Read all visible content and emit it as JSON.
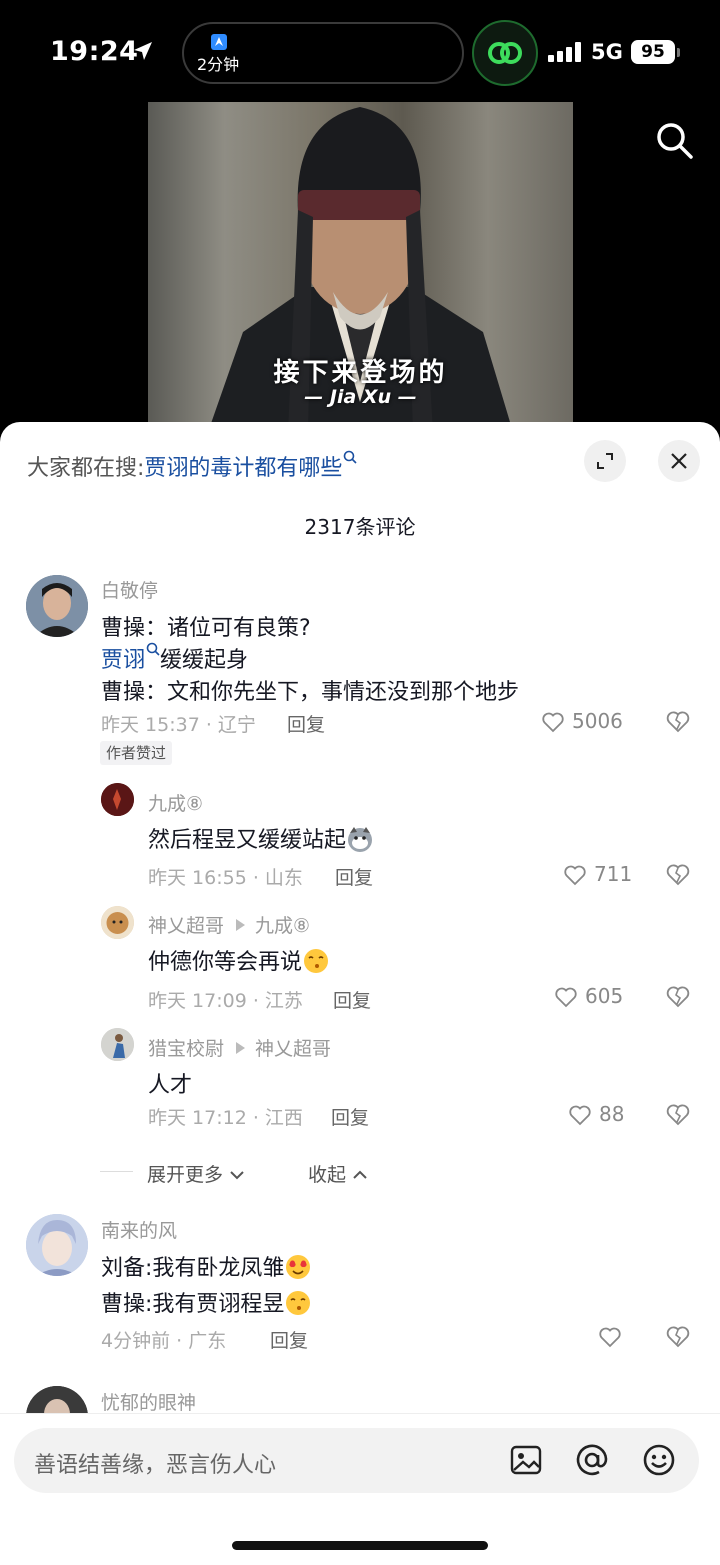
{
  "status_bar": {
    "time": "19:24",
    "island_text": "2分钟",
    "network": "5G",
    "battery": "95"
  },
  "video": {
    "subtitle_cn": "接下来登场的",
    "subtitle_en": "— Jia Xu —"
  },
  "search_hint": {
    "prefix": "大家都在搜:",
    "query": "贾诩的毒计都有哪些"
  },
  "comments_count": "2317条评论",
  "comments": [
    {
      "user": "白敬停",
      "lines": [
        "曹操：诸位可有良策?",
        "缓缓起身",
        "曹操：文和你先坐下，事情还没到那个地步"
      ],
      "link": "贾诩",
      "time_loc": "昨天 15:37 · 辽宁",
      "reply": "回复",
      "likes": "5006",
      "badge": "作者赞过"
    },
    {
      "user": "九成⑧",
      "text": "然后程昱又缓缓站起",
      "time_loc": "昨天 16:55 · 山东",
      "reply": "回复",
      "likes": "711"
    },
    {
      "user": "神乂超哥",
      "reply_to": "九成⑧",
      "text": "仲德你等会再说",
      "time_loc": "昨天 17:09 · 江苏",
      "reply": "回复",
      "likes": "605"
    },
    {
      "user": "猎宝校尉",
      "reply_to": "神乂超哥",
      "text": "人才",
      "time_loc": "昨天 17:12 · 江西",
      "reply": "回复",
      "likes": "88"
    },
    {
      "user": "南来的风",
      "lines": [
        "刘备:我有卧龙凤雏",
        "曹操:我有贾诩程昱"
      ],
      "time_loc": "4分钟前 · 广东",
      "reply": "回复",
      "likes": ""
    },
    {
      "user": "忧郁的眼神"
    }
  ],
  "thread_controls": {
    "expand_more": "展开更多",
    "collapse": "收起"
  },
  "input": {
    "placeholder": "善语结善缘，恶言伤人心"
  },
  "icons": [
    "location-arrow-icon",
    "search-icon",
    "expand-icon",
    "close-icon",
    "heart-icon",
    "broken-heart-icon",
    "image-icon",
    "at-icon",
    "emoji-icon"
  ]
}
